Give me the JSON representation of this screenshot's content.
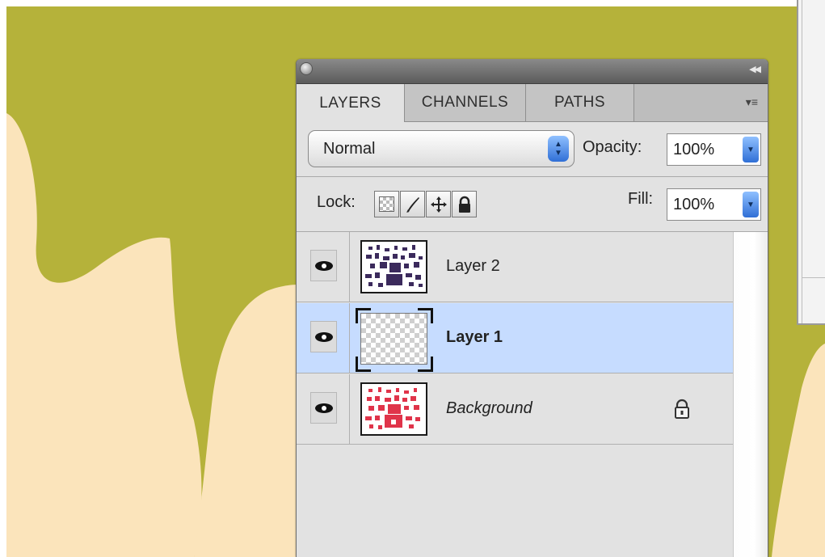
{
  "colors": {
    "background_green": "#b5b23a",
    "background_cream": "#fbe4bb",
    "selected_row": "#c6dcff",
    "accent_blue": "#2f6fd6"
  },
  "panel": {
    "tabs": [
      {
        "label": "LAYERS",
        "active": true
      },
      {
        "label": "CHANNELS",
        "active": false
      },
      {
        "label": "PATHS",
        "active": false
      }
    ],
    "menu_icon": "panel-menu-icon",
    "collapse_icon": "double-arrow-icon",
    "close_icon": "close-icon"
  },
  "blend": {
    "mode": "Normal",
    "opacity_label": "Opacity:",
    "opacity_value": "100%"
  },
  "lock": {
    "label": "Lock:",
    "fill_label": "Fill:",
    "fill_value": "100%",
    "icons": [
      "lock-transparent-pixels-icon",
      "lock-image-pixels-icon",
      "lock-position-icon",
      "lock-all-icon"
    ]
  },
  "layers": [
    {
      "name": "Layer 2",
      "visible": true,
      "selected": false,
      "thumbnail": "dark-purple-pattern",
      "locked": false,
      "italic": false
    },
    {
      "name": "Layer 1",
      "visible": true,
      "selected": true,
      "thumbnail": "transparent",
      "locked": false,
      "italic": false
    },
    {
      "name": "Background",
      "visible": true,
      "selected": false,
      "thumbnail": "red-pattern",
      "locked": true,
      "italic": true
    }
  ]
}
